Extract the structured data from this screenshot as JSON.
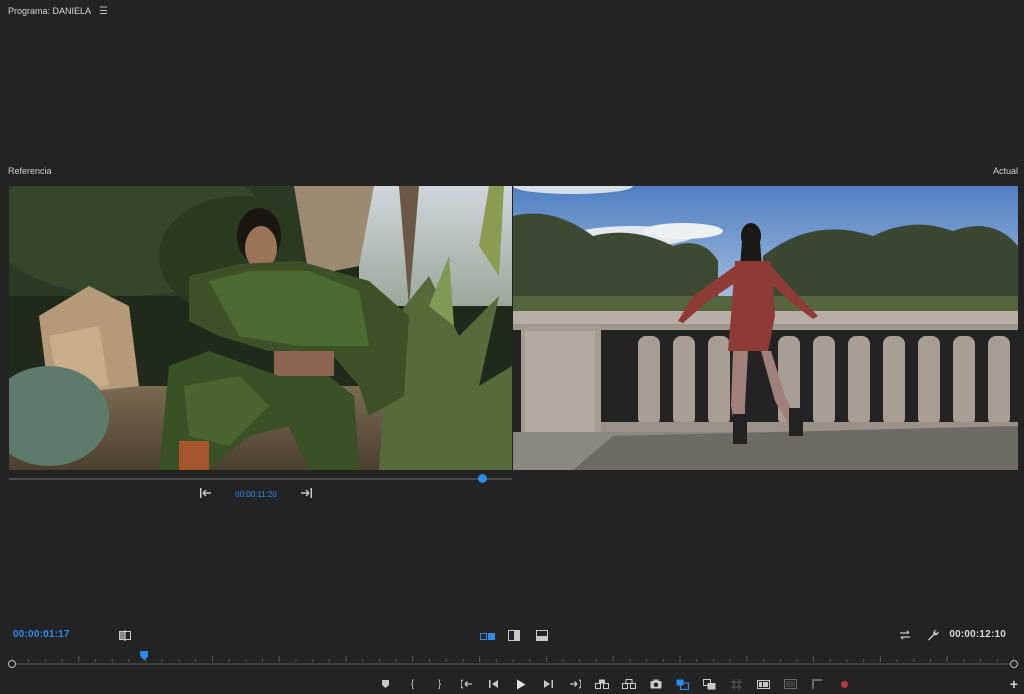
{
  "panel": {
    "title": "Programa: DANIELA",
    "menu_icon": "hamburger-icon"
  },
  "viewers": {
    "reference_label": "Referencia",
    "actual_label": "Actual"
  },
  "reference_controls": {
    "timecode": "00:00:11:20",
    "scrub_position": 0.94
  },
  "program_controls": {
    "current_timecode": "00:00:01:17",
    "duration_timecode": "00:00:12:10",
    "playhead_position": 0.132
  },
  "colors": {
    "accent": "#2d8ceb",
    "background": "#232323",
    "record": "#b33a3a"
  }
}
